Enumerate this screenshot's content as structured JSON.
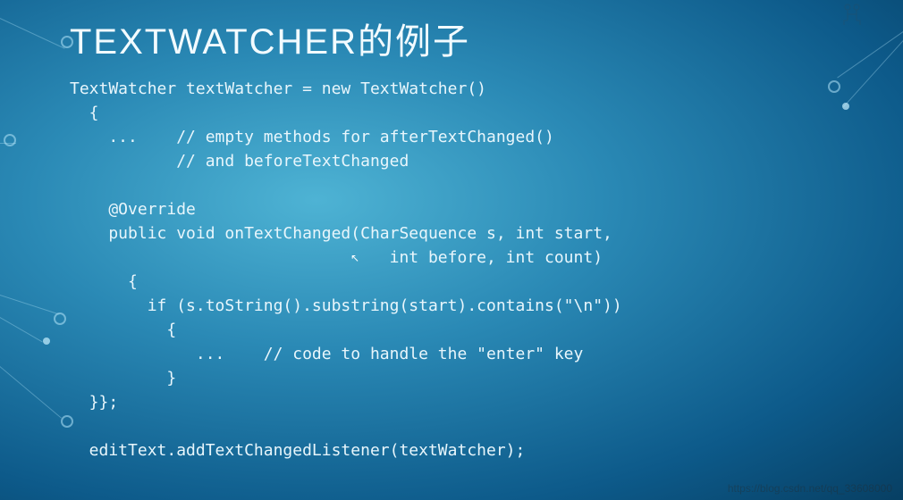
{
  "title": "TEXTWATCHER的例子",
  "code_lines": [
    "TextWatcher textWatcher = new TextWatcher()",
    "  {",
    "    ...    // empty methods for afterTextChanged()",
    "           // and beforeTextChanged",
    "",
    "    @Override",
    "    public void onTextChanged(CharSequence s, int start,",
    "                                 int before, int count)",
    "      {",
    "        if (s.toString().substring(start).contains(\"\\n\"))",
    "          {",
    "             ...    // code to handle the \"enter\" key",
    "          }",
    "  }};",
    "",
    "  editText.addTextChangedListener(textWatcher);"
  ],
  "watermark_url": "https://blog.csdn.net/qq_33608000",
  "watermark_logo_text": "⺌"
}
